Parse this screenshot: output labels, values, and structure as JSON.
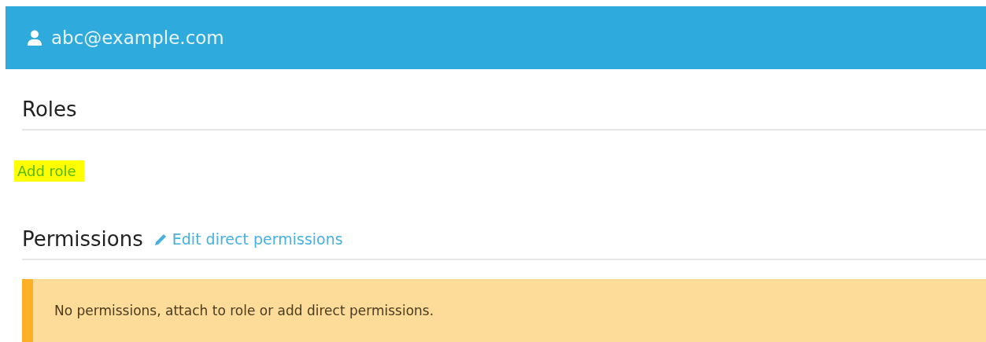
{
  "header": {
    "user": "abc@example.com"
  },
  "roles": {
    "title": "Roles",
    "add_link": {
      "label": "Add role",
      "highlighted": true
    }
  },
  "permissions": {
    "title": "Permissions",
    "edit_link": "Edit direct permissions",
    "alert": {
      "kind": "warning",
      "text": "No permissions, attach to role or add direct permissions."
    }
  }
}
